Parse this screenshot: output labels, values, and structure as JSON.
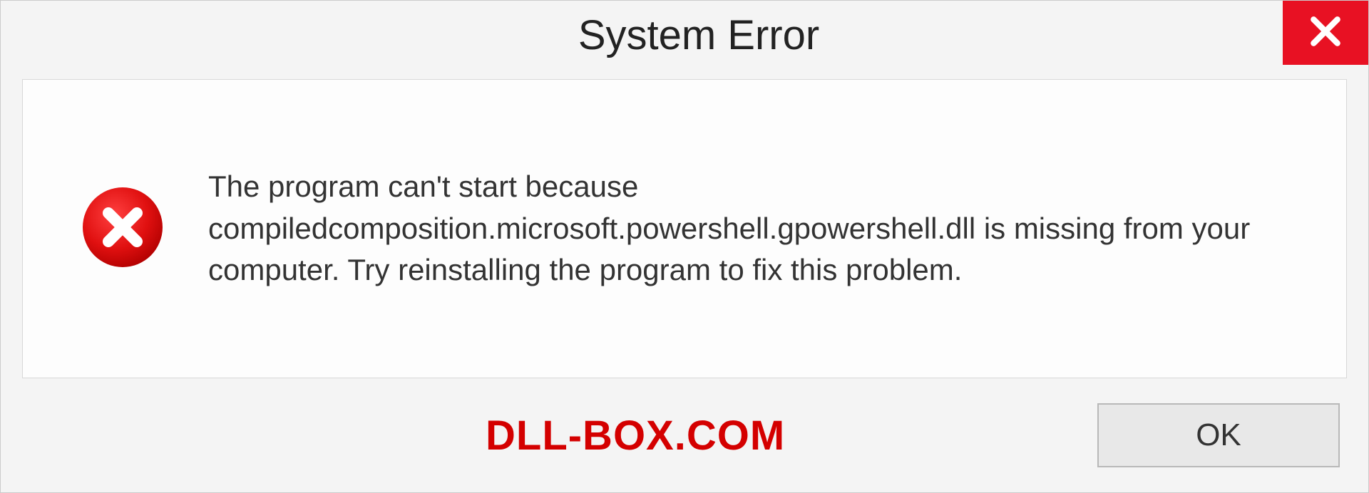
{
  "dialog": {
    "title": "System Error",
    "message": "The program can't start because compiledcomposition.microsoft.powershell.gpowershell.dll is missing from your computer. Try reinstalling the program to fix this problem.",
    "ok_label": "OK"
  },
  "watermark": "DLL-BOX.COM"
}
